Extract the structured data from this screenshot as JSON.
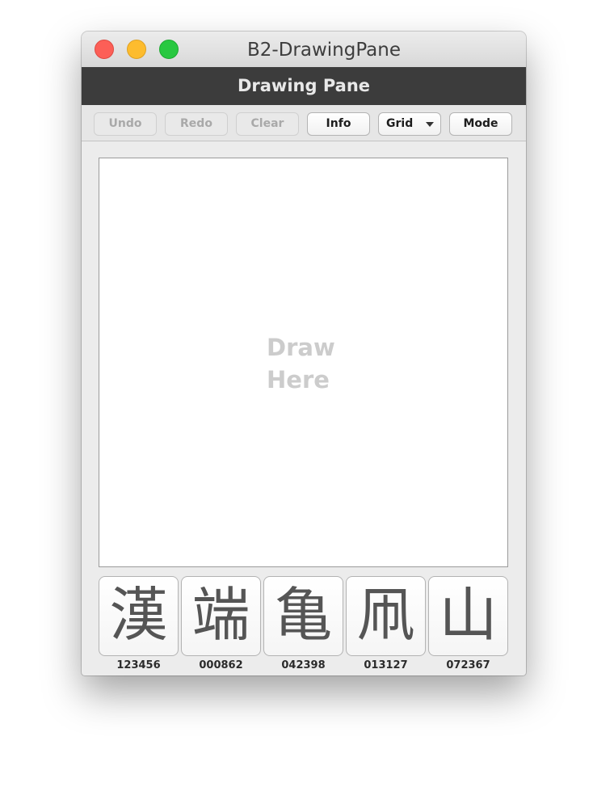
{
  "window": {
    "title": "B2-DrawingPane"
  },
  "header": {
    "title": "Drawing Pane"
  },
  "toolbar": {
    "undo_label": "Undo",
    "redo_label": "Redo",
    "clear_label": "Clear",
    "info_label": "Info",
    "grid_label": "Grid",
    "mode_label": "Mode"
  },
  "canvas": {
    "placeholder_line1": "Draw",
    "placeholder_line2": "Here"
  },
  "candidates": [
    {
      "glyph": "漢",
      "code": "123456"
    },
    {
      "glyph": "端",
      "code": "000862"
    },
    {
      "glyph": "亀",
      "code": "042398"
    },
    {
      "glyph": "凧",
      "code": "013127"
    },
    {
      "glyph": "山",
      "code": "072367"
    }
  ],
  "colors": {
    "header_bg": "#3c3c3c",
    "close": "#fc5f57",
    "minimize": "#fdbc2e",
    "maximize": "#28c840"
  }
}
